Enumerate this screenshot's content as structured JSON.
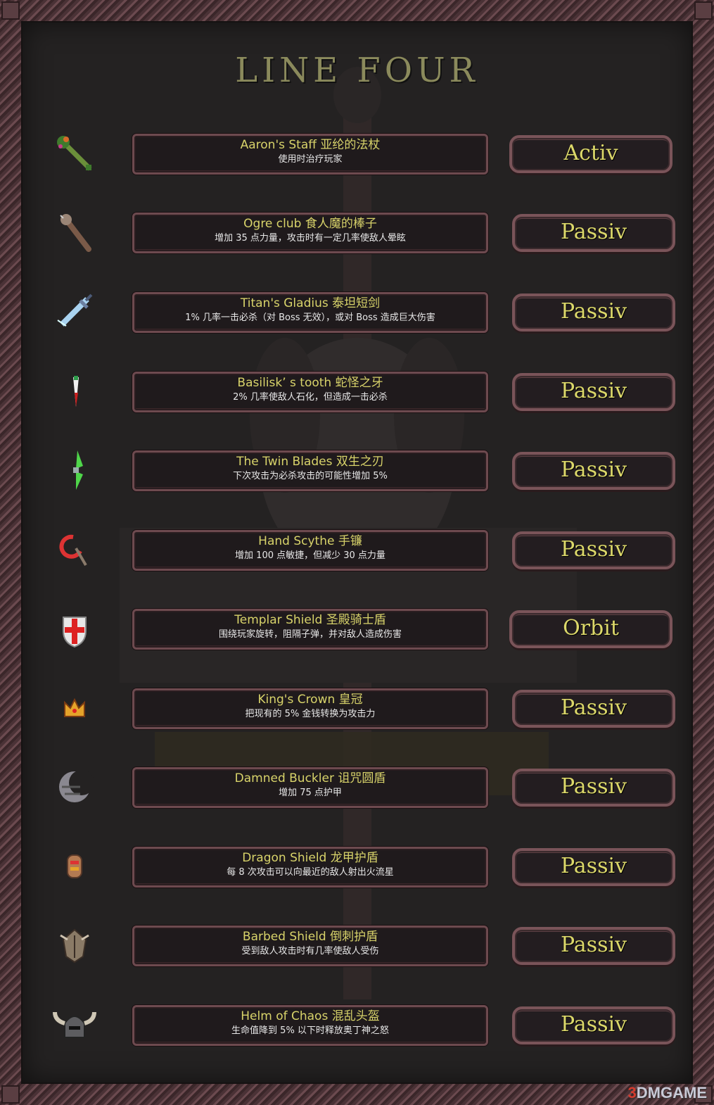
{
  "page": {
    "title": "LINE FOUR"
  },
  "items": [
    {
      "name": "Aaron's Staff 亚纶的法杖",
      "desc": "使用时治疗玩家",
      "type": "Activ",
      "icon": "staff-icon"
    },
    {
      "name": "Ogre club 食人魔的棒子",
      "desc": "增加 35 点力量，攻击时有一定几率使敌人晕眩",
      "type": "Passiv",
      "icon": "club-icon"
    },
    {
      "name": "Titan's Gladius 泰坦短剑",
      "desc": "1% 几率一击必杀（对 Boss 无效），或对 Boss 造成巨大伤害",
      "type": "Passiv",
      "icon": "gladius-icon"
    },
    {
      "name": "Basilisk’ s tooth 蛇怪之牙",
      "desc": "2% 几率使敌人石化，但造成一击必杀",
      "type": "Passiv",
      "icon": "tooth-icon"
    },
    {
      "name": "The Twin Blades 双生之刃",
      "desc": "下次攻击为必杀攻击的可能性增加 5%",
      "type": "Passiv",
      "icon": "twin-blades-icon"
    },
    {
      "name": "Hand Scythe 手镰",
      "desc": "增加 100 点敏捷，但减少 30 点力量",
      "type": "Passiv",
      "icon": "scythe-icon"
    },
    {
      "name": "Templar Shield 圣殿骑士盾",
      "desc": "围绕玩家旋转，阻隔子弹，并对敌人造成伤害",
      "type": "Orbit",
      "icon": "templar-shield-icon"
    },
    {
      "name": "King's Crown 皇冠",
      "desc": "把现有的 5% 金钱转换为攻击力",
      "type": "Passiv",
      "icon": "crown-icon"
    },
    {
      "name": "Damned Buckler 诅咒圆盾",
      "desc": "增加 75 点护甲",
      "type": "Passiv",
      "icon": "buckler-icon"
    },
    {
      "name": "Dragon Shield 龙甲护盾",
      "desc": "每 8 次攻击可以向最近的敌人射出火流星",
      "type": "Passiv",
      "icon": "dragon-shield-icon"
    },
    {
      "name": "Barbed Shield 倒刺护盾",
      "desc": "受到敌人攻击时有几率使敌人受伤",
      "type": "Passiv",
      "icon": "barbed-shield-icon"
    },
    {
      "name": "Helm of Chaos 混乱头盔",
      "desc": "生命值降到 5% 以下时释放奥丁神之怒",
      "type": "Passiv",
      "icon": "helm-icon"
    }
  ],
  "watermark": {
    "prefix": "3",
    "text": "DMGAME"
  },
  "colors": {
    "title": "#8b8a5c",
    "item_name": "#d8d36a",
    "type_label": "#dcd86a",
    "border": "#6d4a4f"
  }
}
